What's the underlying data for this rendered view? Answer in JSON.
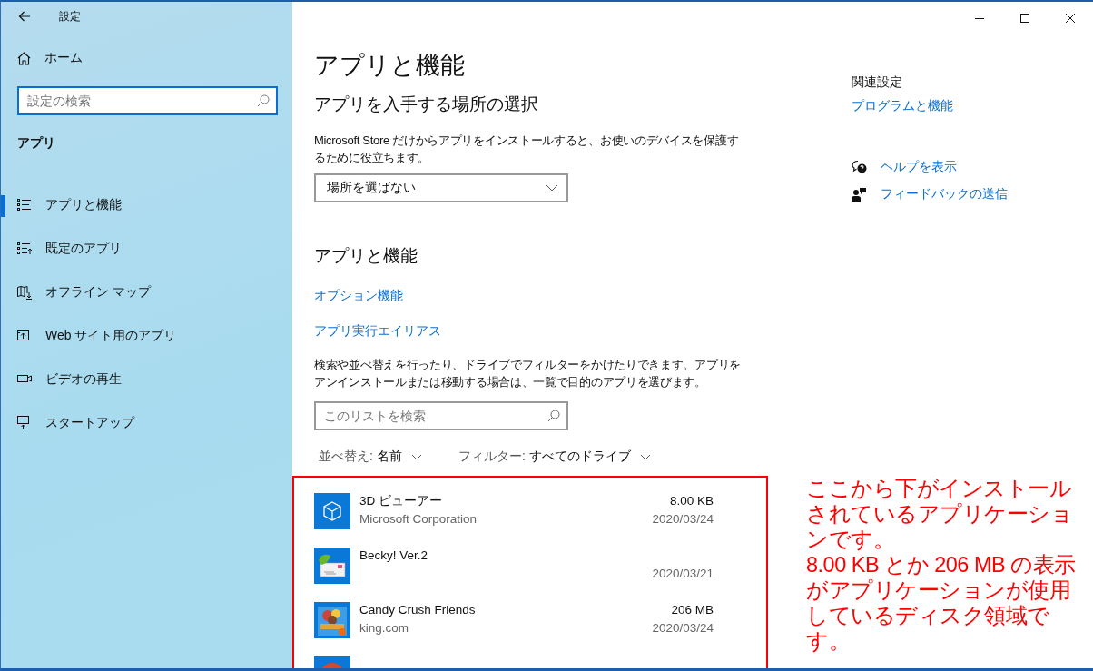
{
  "window": {
    "title": "設定"
  },
  "sidebar": {
    "home": "ホーム",
    "search": {
      "placeholder": "設定の検索",
      "focused": true
    },
    "section": "アプリ",
    "items": [
      {
        "label": "アプリと機能",
        "kind": "list",
        "selected": true
      },
      {
        "label": "既定のアプリ",
        "kind": "defaults",
        "selected": false
      },
      {
        "label": "オフライン マップ",
        "kind": "map",
        "selected": false
      },
      {
        "label": "Web サイト用のアプリ",
        "kind": "web",
        "selected": false
      },
      {
        "label": "ビデオの再生",
        "kind": "video",
        "selected": false
      },
      {
        "label": "スタートアップ",
        "kind": "startup",
        "selected": false
      }
    ]
  },
  "main": {
    "title": "アプリと機能",
    "store": {
      "heading": "アプリを入手する場所の選択",
      "description": "Microsoft Store だけからアプリをインストールすると、お使いのデバイスを保護するために役立ちます。",
      "dropdown": {
        "value": "場所を選ばない"
      }
    },
    "apps_section": {
      "heading": "アプリと機能",
      "links": [
        "オプション機能",
        "アプリ実行エイリアス"
      ],
      "description": "検索や並べ替えを行ったり、ドライブでフィルターをかけたりできます。アプリをアンインストールまたは移動する場合は、一覧で目的のアプリを選びます。",
      "search": {
        "placeholder": "このリストを検索"
      },
      "sort": {
        "label": "並べ替え:",
        "value": "名前"
      },
      "filter": {
        "label": "フィルター:",
        "value": "すべてのドライブ"
      },
      "apps": [
        {
          "kind": "cube",
          "name": "3D ビューアー",
          "publisher": "Microsoft Corporation",
          "size": "8.00 KB",
          "date": "2020/03/24"
        },
        {
          "kind": "mail",
          "name": "Becky! Ver.2",
          "date": "2020/03/21"
        },
        {
          "kind": "game",
          "name": "Candy Crush Friends",
          "publisher": "king.com",
          "size": "206 MB",
          "date": "2020/03/24"
        },
        {
          "kind": "partial"
        }
      ]
    }
  },
  "related": {
    "heading": "関連設定",
    "links": [
      "プログラムと機能"
    ]
  },
  "help": [
    {
      "kind": "help",
      "label": "ヘルプを表示"
    },
    {
      "kind": "feedback",
      "label": "フィードバックの送信"
    }
  ],
  "annotation": {
    "paragraphs": [
      "ここから下がインストールされているアプリケーションです。",
      "8.00 KB とか 206 MB の表示がアプリケーションが使用しているディスク領域です。"
    ]
  }
}
